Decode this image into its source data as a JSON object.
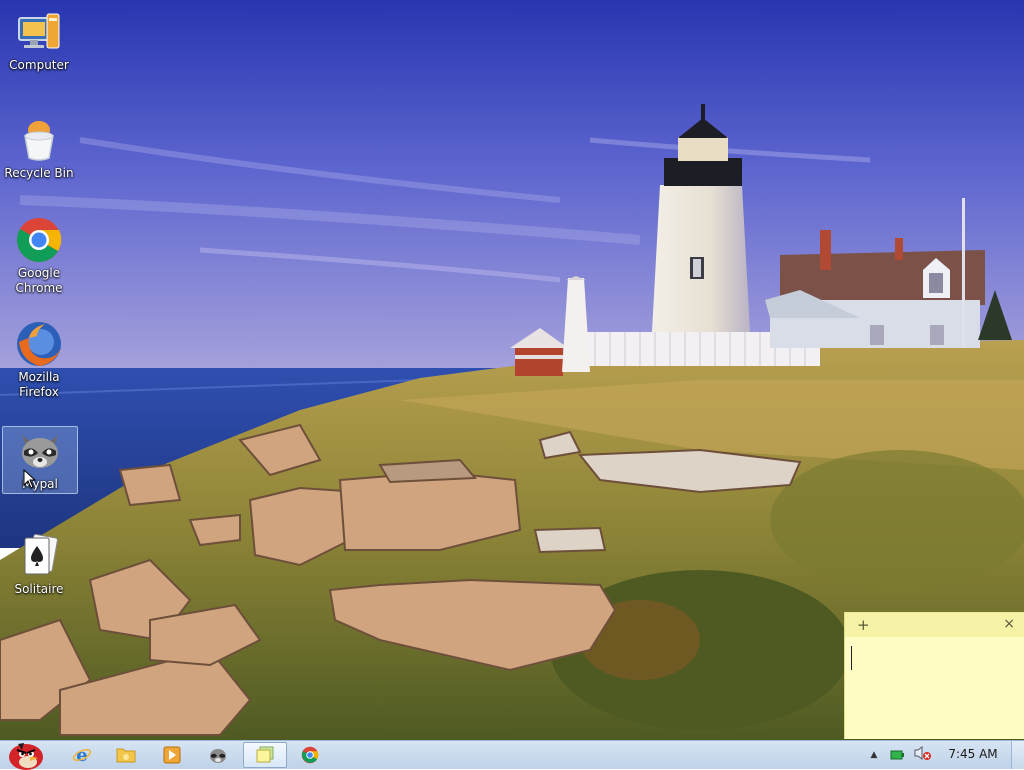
{
  "desktop": {
    "icons": [
      {
        "label": "Computer",
        "icon": "computer-icon"
      },
      {
        "label": "Recycle Bin",
        "icon": "recycle-bin-icon"
      },
      {
        "label": "Google\nChrome",
        "icon": "chrome-icon"
      },
      {
        "label": "Mozilla\nFirefox",
        "icon": "firefox-icon"
      },
      {
        "label": "Mypal",
        "icon": "mypal-raccoon-icon"
      },
      {
        "label": "Solitaire",
        "icon": "solitaire-icon"
      }
    ],
    "selected_icon": "Mypal"
  },
  "sticky_note": {
    "add_label": "+",
    "close_label": "×",
    "text": ""
  },
  "taskbar": {
    "pinned": [
      {
        "name": "start-button",
        "icon": "angry-bird-start-icon"
      },
      {
        "name": "internet-explorer",
        "icon": "ie-icon"
      },
      {
        "name": "file-explorer",
        "icon": "folder-icon"
      },
      {
        "name": "media-player",
        "icon": "media-player-icon"
      },
      {
        "name": "mypal",
        "icon": "mypal-raccoon-icon"
      },
      {
        "name": "sticky-notes",
        "icon": "sticky-notes-icon",
        "active": true
      },
      {
        "name": "google-chrome",
        "icon": "chrome-icon"
      }
    ],
    "tray": {
      "show_hidden_label": "▲",
      "icons": [
        "battery-icon",
        "volume-muted-icon"
      ]
    },
    "clock": "7:45 AM"
  },
  "colors": {
    "sky_top": "#2e3fb5",
    "sky_bottom": "#8b8fd8",
    "sea": "#2b4ea8",
    "grass": "#8e8a3a",
    "sticky_bg": "#fdfdc4",
    "taskbar": "#c9dbef"
  }
}
